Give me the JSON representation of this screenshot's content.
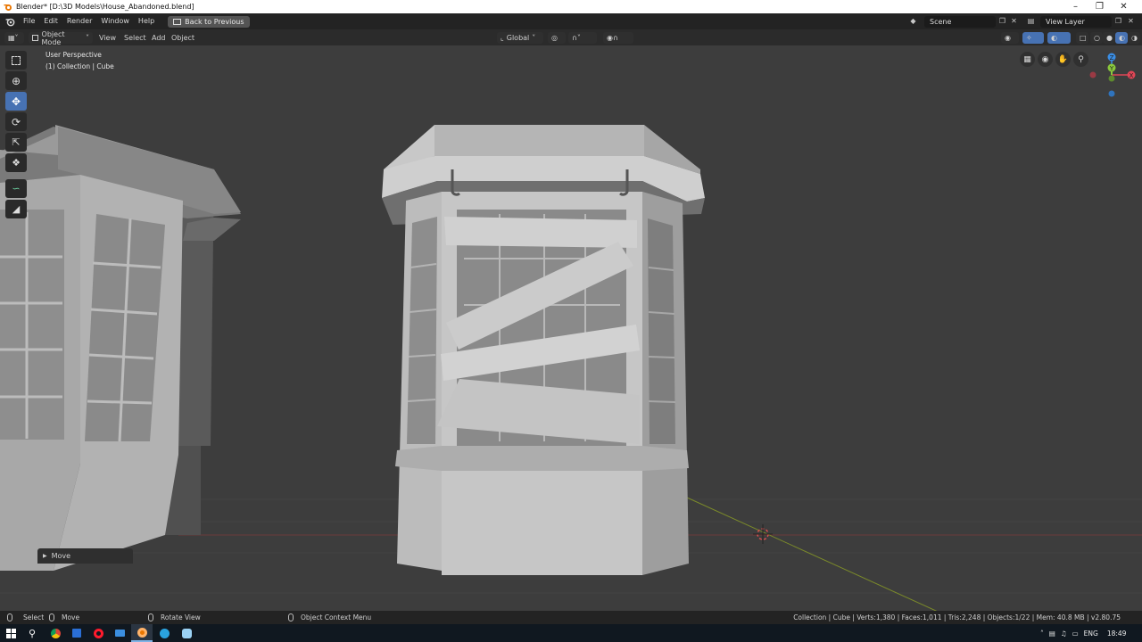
{
  "window": {
    "title": "Blender* [D:\\3D Models\\House_Abandoned.blend]",
    "controls": [
      "minimize-icon",
      "maximize-icon",
      "close-icon"
    ]
  },
  "topbar": {
    "menus": [
      "File",
      "Edit",
      "Render",
      "Window",
      "Help"
    ],
    "back_button": "Back to Previous",
    "scene": "Scene",
    "view_layer": "View Layer"
  },
  "viewport_header": {
    "mode": "Object Mode",
    "menus": [
      "View",
      "Select",
      "Add",
      "Object"
    ],
    "orientation": "Global"
  },
  "viewport": {
    "perspective": "User Perspective",
    "collection_info": "(1) Collection | Cube"
  },
  "toolbar": {
    "tools": [
      "select-box-icon",
      "cursor-icon",
      "move-icon",
      "rotate-icon",
      "scale-icon",
      "transform-icon",
      "annotate-icon",
      "measure-icon"
    ],
    "active_tool": "move-icon"
  },
  "gizmo": {
    "axes": [
      "X",
      "Y",
      "Z"
    ],
    "colors": {
      "x": "#e04656",
      "y": "#8ac83c",
      "z": "#3a8ee6"
    }
  },
  "operator_panel": {
    "label": "Move"
  },
  "statusbar": {
    "select": "Select",
    "move": "Move",
    "rotate": "Rotate View",
    "context": "Object Context Menu",
    "stats": "Collection | Cube | Verts:1,380 | Faces:1,011 | Tris:2,248 | Objects:1/22 | Mem: 40.8 MB | v2.80.75"
  },
  "taskbar": {
    "language": "ENG",
    "time": "18:49"
  },
  "colors": {
    "accent": "#4772b3",
    "viewport_bg": "#3d3d3d",
    "header_bg": "#2b2b2b"
  }
}
